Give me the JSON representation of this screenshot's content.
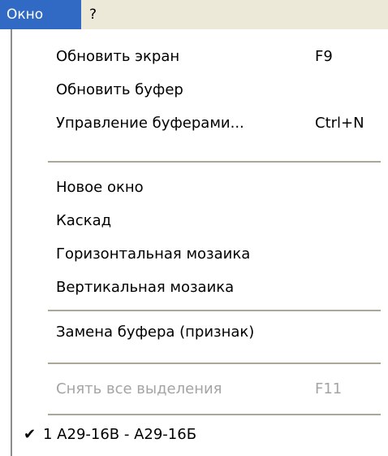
{
  "menubar": {
    "window_label": "Окно",
    "help_label": "?"
  },
  "menu": {
    "refresh_screen": {
      "label": "Обновить экран",
      "shortcut": "F9"
    },
    "refresh_buffer": {
      "label": "Обновить буфер"
    },
    "manage_buffers": {
      "label": "Управление буферами...",
      "shortcut": "Ctrl+N"
    },
    "new_window": {
      "label": "Новое окно"
    },
    "cascade": {
      "label": "Каскад"
    },
    "tile_horizontal": {
      "label": "Горизонтальная мозаика"
    },
    "tile_vertical": {
      "label": "Вертикальная мозаика"
    },
    "replace_buffer": {
      "label": "Замена буфера (признак)"
    },
    "clear_selections": {
      "label": "Снять все выделения",
      "shortcut": "F11",
      "enabled": false
    },
    "window_entry": {
      "label": "1 А29-16В - А29-16Б",
      "checked": true,
      "check_glyph": "✔"
    }
  }
}
